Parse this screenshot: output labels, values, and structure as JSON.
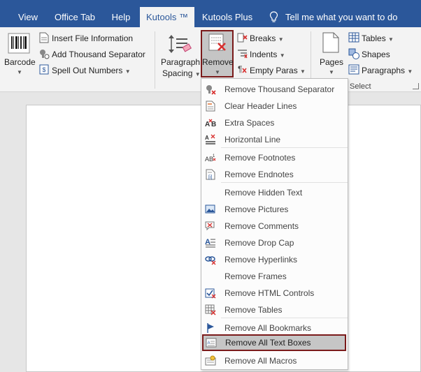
{
  "tabs": [
    {
      "label": "View",
      "active": false
    },
    {
      "label": "Office Tab",
      "active": false
    },
    {
      "label": "Help",
      "active": false
    },
    {
      "label": "Kutools ™",
      "active": true
    },
    {
      "label": "Kutools Plus",
      "active": false
    }
  ],
  "tell_me": "Tell me what you want to do",
  "ribbon": {
    "barcode": "Barcode",
    "insert_file_info": "Insert File Information",
    "add_thousand_sep": "Add Thousand Separator",
    "spell_out_numbers": "Spell Out Numbers",
    "paragraph": "Paragraph",
    "spacing": "Spacing",
    "remove": "Remove",
    "breaks": "Breaks",
    "indents": "Indents",
    "empty_paras": "Empty Paras",
    "pages": "Pages",
    "tables": "Tables",
    "shapes": "Shapes",
    "paragraphs": "Paragraphs",
    "select_group": "Select"
  },
  "menu": {
    "items": [
      {
        "label": "Remove Thousand Separator",
        "icon": "thousand-separator-icon"
      },
      {
        "label": "Clear Header Lines",
        "icon": "header-lines-icon"
      },
      {
        "label": "Extra Spaces",
        "icon": "extra-spaces-icon"
      },
      {
        "label": "Horizontal Line",
        "icon": "horizontal-line-icon"
      },
      {
        "label": "Remove Footnotes",
        "icon": "footnotes-icon"
      },
      {
        "label": "Remove Endnotes",
        "icon": "endnotes-icon"
      },
      {
        "label": "Remove Hidden Text",
        "icon": ""
      },
      {
        "label": "Remove Pictures",
        "icon": "pictures-icon"
      },
      {
        "label": "Remove Comments",
        "icon": "comments-icon"
      },
      {
        "label": "Remove Drop Cap",
        "icon": "drop-cap-icon"
      },
      {
        "label": "Remove Hyperlinks",
        "icon": "hyperlinks-icon"
      },
      {
        "label": "Remove Frames",
        "icon": ""
      },
      {
        "label": "Remove HTML Controls",
        "icon": "html-controls-icon"
      },
      {
        "label": "Remove Tables",
        "icon": "tables-icon"
      },
      {
        "label": "Remove All Bookmarks",
        "icon": "bookmark-flag-icon"
      },
      {
        "label": "Remove All Text Boxes",
        "icon": "text-box-icon",
        "highlighted": true
      },
      {
        "label": "Remove All Macros",
        "icon": "macros-icon"
      }
    ]
  },
  "colors": {
    "tab_bar": "#2b579a",
    "highlight_border": "#7a1a1a",
    "ribbon_bg": "#f3f3f3"
  }
}
